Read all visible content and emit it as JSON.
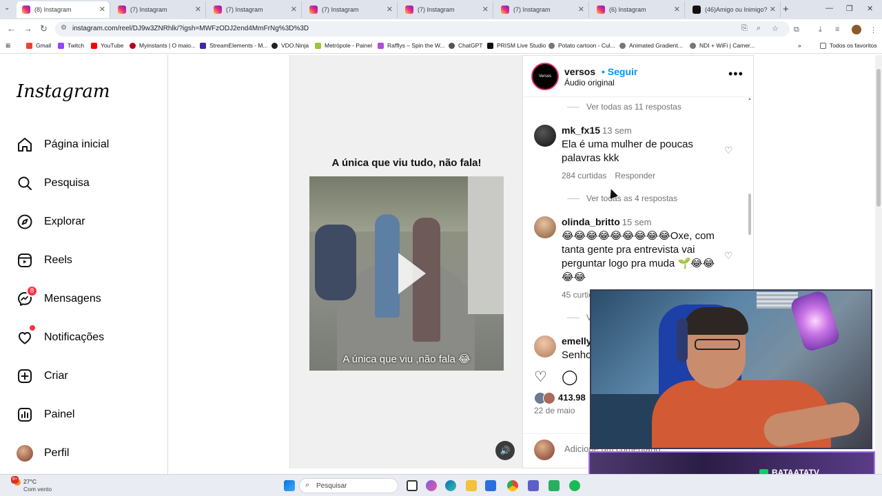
{
  "browser": {
    "tabs": [
      {
        "title": "(8) Instagram",
        "active": true
      },
      {
        "title": "(7) Instagram"
      },
      {
        "title": "(7) Instagram"
      },
      {
        "title": "(7) Instagram"
      },
      {
        "title": "(7) Instagram"
      },
      {
        "title": "(7) Instagram"
      },
      {
        "title": "(6) Instagram"
      },
      {
        "title": "(46)Amigo ou Inimigo?"
      }
    ],
    "url": "instagram.com/reel/DJ9w3ZNRhlk/?igsh=MWFzODJ2end4MmFrNg%3D%3D",
    "bookmarks": [
      "Gmail",
      "Twitch",
      "YouTube",
      "Myinstants | O maio...",
      "StreamElements - M...",
      "VDO.Ninja",
      "Metrópole - Painel",
      "Rafflys – Spin the W...",
      "ChatGPT",
      "PRISM Live Studio",
      "Potato cartoon - Cul...",
      "Animated Gradient...",
      "NDI + WiFi | Camer..."
    ],
    "all_bookmarks": "Todos os favoritos"
  },
  "sidebar": {
    "logo": "Instagram",
    "items": [
      {
        "label": "Página inicial",
        "icon": "home-icon"
      },
      {
        "label": "Pesquisa",
        "icon": "search-icon"
      },
      {
        "label": "Explorar",
        "icon": "compass-icon"
      },
      {
        "label": "Reels",
        "icon": "reels-icon"
      },
      {
        "label": "Mensagens",
        "icon": "messenger-icon",
        "badge": "8"
      },
      {
        "label": "Notificações",
        "icon": "heart-icon"
      },
      {
        "label": "Criar",
        "icon": "plus-square-icon"
      },
      {
        "label": "Painel",
        "icon": "chart-icon"
      },
      {
        "label": "Perfil",
        "icon": "avatar-icon"
      }
    ]
  },
  "reel": {
    "title": "A única que viu tudo, não fala!",
    "caption": "A única que viu ,não fala 😂"
  },
  "post": {
    "author": "versos",
    "avatar_text": "Versos",
    "follow": "Seguir",
    "audio": "Áudio original",
    "view_replies_top": "Ver todas as 11 respostas",
    "comments": [
      {
        "user": "mk_fx15",
        "time": "13 sem",
        "text": "Ela é uma mulher de poucas palavras kkk",
        "likes": "284 curtidas",
        "reply": "Responder",
        "view_replies": "Ver todas as 4 respostas"
      },
      {
        "user": "olinda_britto",
        "time": "15 sem",
        "text": "😂😂😂😂😂😂😂😂😂Oxe, com tanta gente pra entrevista vai perguntar logo pra muda 🌱😂😂😂😂",
        "likes": "45 curtidas",
        "view_replies": "Ver"
      },
      {
        "user": "emelly",
        "text": "Senho"
      }
    ],
    "like_count": "413.98",
    "date": "22 de maio",
    "add_comment": "Adicione um comentário..."
  },
  "stream": {
    "channel": "BATAATATV"
  },
  "taskbar": {
    "temp": "27°C",
    "weather": "Com vento",
    "weather_badge": "9+",
    "search": "Pesquisar"
  }
}
